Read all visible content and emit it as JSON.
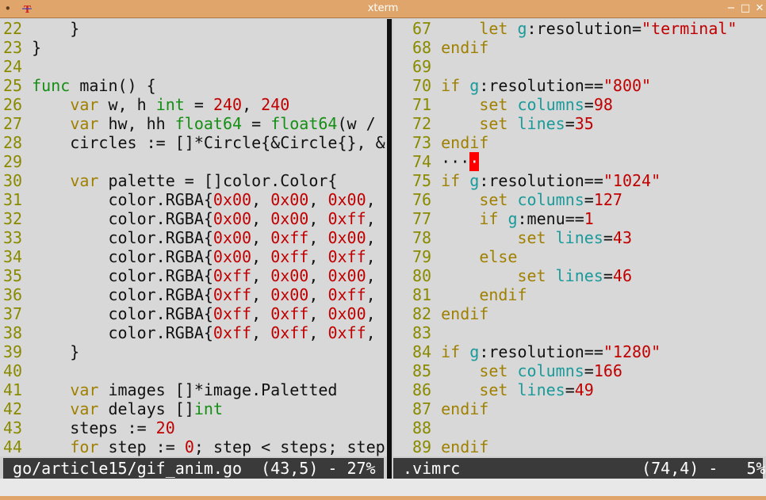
{
  "window": {
    "title": "xterm",
    "menu_glyph": "•",
    "app_glyph": "T",
    "minimize": "−",
    "maximize": "□",
    "close": "✕"
  },
  "left_pane": {
    "lines": [
      [
        {
          "t": "22",
          "c": "ln"
        },
        {
          "t": "     }",
          "c": "pl"
        }
      ],
      [
        {
          "t": "23",
          "c": "ln"
        },
        {
          "t": " }",
          "c": "pl"
        }
      ],
      [
        {
          "t": "24",
          "c": "ln"
        }
      ],
      [
        {
          "t": "25",
          "c": "ln"
        },
        {
          "t": " ",
          "c": "pl"
        },
        {
          "t": "func",
          "c": "ty"
        },
        {
          "t": " main() {",
          "c": "pl"
        }
      ],
      [
        {
          "t": "26",
          "c": "ln"
        },
        {
          "t": "     ",
          "c": "pl"
        },
        {
          "t": "var",
          "c": "kw"
        },
        {
          "t": " w, h ",
          "c": "pl"
        },
        {
          "t": "int",
          "c": "ty"
        },
        {
          "t": " = ",
          "c": "pl"
        },
        {
          "t": "240",
          "c": "nm"
        },
        {
          "t": ", ",
          "c": "pl"
        },
        {
          "t": "240",
          "c": "nm"
        }
      ],
      [
        {
          "t": "27",
          "c": "ln"
        },
        {
          "t": "     ",
          "c": "pl"
        },
        {
          "t": "var",
          "c": "kw"
        },
        {
          "t": " hw, hh ",
          "c": "pl"
        },
        {
          "t": "float64",
          "c": "ty"
        },
        {
          "t": " = ",
          "c": "pl"
        },
        {
          "t": "float64",
          "c": "ty"
        },
        {
          "t": "(w /",
          "c": "pl"
        }
      ],
      [
        {
          "t": "28",
          "c": "ln"
        },
        {
          "t": "     circles := []*Circle{&Circle{}, &",
          "c": "pl"
        }
      ],
      [
        {
          "t": "29",
          "c": "ln"
        }
      ],
      [
        {
          "t": "30",
          "c": "ln"
        },
        {
          "t": "     ",
          "c": "pl"
        },
        {
          "t": "var",
          "c": "kw"
        },
        {
          "t": " palette = []color.Color{",
          "c": "pl"
        }
      ],
      [
        {
          "t": "31",
          "c": "ln"
        },
        {
          "t": "         color.RGBA{",
          "c": "pl"
        },
        {
          "t": "0x00",
          "c": "nm"
        },
        {
          "t": ", ",
          "c": "pl"
        },
        {
          "t": "0x00",
          "c": "nm"
        },
        {
          "t": ", ",
          "c": "pl"
        },
        {
          "t": "0x00",
          "c": "nm"
        },
        {
          "t": ",",
          "c": "pl"
        }
      ],
      [
        {
          "t": "32",
          "c": "ln"
        },
        {
          "t": "         color.RGBA{",
          "c": "pl"
        },
        {
          "t": "0x00",
          "c": "nm"
        },
        {
          "t": ", ",
          "c": "pl"
        },
        {
          "t": "0x00",
          "c": "nm"
        },
        {
          "t": ", ",
          "c": "pl"
        },
        {
          "t": "0xff",
          "c": "nm"
        },
        {
          "t": ",",
          "c": "pl"
        }
      ],
      [
        {
          "t": "33",
          "c": "ln"
        },
        {
          "t": "         color.RGBA{",
          "c": "pl"
        },
        {
          "t": "0x00",
          "c": "nm"
        },
        {
          "t": ", ",
          "c": "pl"
        },
        {
          "t": "0xff",
          "c": "nm"
        },
        {
          "t": ", ",
          "c": "pl"
        },
        {
          "t": "0x00",
          "c": "nm"
        },
        {
          "t": ",",
          "c": "pl"
        }
      ],
      [
        {
          "t": "34",
          "c": "ln"
        },
        {
          "t": "         color.RGBA{",
          "c": "pl"
        },
        {
          "t": "0x00",
          "c": "nm"
        },
        {
          "t": ", ",
          "c": "pl"
        },
        {
          "t": "0xff",
          "c": "nm"
        },
        {
          "t": ", ",
          "c": "pl"
        },
        {
          "t": "0xff",
          "c": "nm"
        },
        {
          "t": ",",
          "c": "pl"
        }
      ],
      [
        {
          "t": "35",
          "c": "ln"
        },
        {
          "t": "         color.RGBA{",
          "c": "pl"
        },
        {
          "t": "0xff",
          "c": "nm"
        },
        {
          "t": ", ",
          "c": "pl"
        },
        {
          "t": "0x00",
          "c": "nm"
        },
        {
          "t": ", ",
          "c": "pl"
        },
        {
          "t": "0x00",
          "c": "nm"
        },
        {
          "t": ",",
          "c": "pl"
        }
      ],
      [
        {
          "t": "36",
          "c": "ln"
        },
        {
          "t": "         color.RGBA{",
          "c": "pl"
        },
        {
          "t": "0xff",
          "c": "nm"
        },
        {
          "t": ", ",
          "c": "pl"
        },
        {
          "t": "0x00",
          "c": "nm"
        },
        {
          "t": ", ",
          "c": "pl"
        },
        {
          "t": "0xff",
          "c": "nm"
        },
        {
          "t": ",",
          "c": "pl"
        }
      ],
      [
        {
          "t": "37",
          "c": "ln"
        },
        {
          "t": "         color.RGBA{",
          "c": "pl"
        },
        {
          "t": "0xff",
          "c": "nm"
        },
        {
          "t": ", ",
          "c": "pl"
        },
        {
          "t": "0xff",
          "c": "nm"
        },
        {
          "t": ", ",
          "c": "pl"
        },
        {
          "t": "0x00",
          "c": "nm"
        },
        {
          "t": ",",
          "c": "pl"
        }
      ],
      [
        {
          "t": "38",
          "c": "ln"
        },
        {
          "t": "         color.RGBA{",
          "c": "pl"
        },
        {
          "t": "0xff",
          "c": "nm"
        },
        {
          "t": ", ",
          "c": "pl"
        },
        {
          "t": "0xff",
          "c": "nm"
        },
        {
          "t": ", ",
          "c": "pl"
        },
        {
          "t": "0xff",
          "c": "nm"
        },
        {
          "t": ",",
          "c": "pl"
        }
      ],
      [
        {
          "t": "39",
          "c": "ln"
        },
        {
          "t": "     }",
          "c": "pl"
        }
      ],
      [
        {
          "t": "40",
          "c": "ln"
        }
      ],
      [
        {
          "t": "41",
          "c": "ln"
        },
        {
          "t": "     ",
          "c": "pl"
        },
        {
          "t": "var",
          "c": "kw"
        },
        {
          "t": " images []*image.Paletted",
          "c": "pl"
        }
      ],
      [
        {
          "t": "42",
          "c": "ln"
        },
        {
          "t": "     ",
          "c": "pl"
        },
        {
          "t": "var",
          "c": "kw"
        },
        {
          "t": " delays []",
          "c": "pl"
        },
        {
          "t": "int",
          "c": "ty"
        }
      ],
      [
        {
          "t": "43",
          "c": "ln"
        },
        {
          "t": "     steps := ",
          "c": "pl"
        },
        {
          "t": "20",
          "c": "nm"
        }
      ],
      [
        {
          "t": "44",
          "c": "ln"
        },
        {
          "t": "     ",
          "c": "pl"
        },
        {
          "t": "for",
          "c": "kw"
        },
        {
          "t": " step := ",
          "c": "pl"
        },
        {
          "t": "0",
          "c": "nm"
        },
        {
          "t": "; step < steps; step",
          "c": "pl"
        }
      ]
    ]
  },
  "right_pane": {
    "lines": [
      [
        {
          "t": "67",
          "c": "ln"
        },
        {
          "t": "     ",
          "c": "pl"
        },
        {
          "t": "let",
          "c": "kw"
        },
        {
          "t": " ",
          "c": "pl"
        },
        {
          "t": "g",
          "c": "id"
        },
        {
          "t": ":resolution=",
          "c": "pl"
        },
        {
          "t": "\"terminal\"",
          "c": "st"
        }
      ],
      [
        {
          "t": "68",
          "c": "ln"
        },
        {
          "t": " ",
          "c": "pl"
        },
        {
          "t": "endif",
          "c": "kw"
        }
      ],
      [
        {
          "t": "69",
          "c": "ln"
        }
      ],
      [
        {
          "t": "70",
          "c": "ln"
        },
        {
          "t": " ",
          "c": "pl"
        },
        {
          "t": "if",
          "c": "kw"
        },
        {
          "t": " ",
          "c": "pl"
        },
        {
          "t": "g",
          "c": "id"
        },
        {
          "t": ":resolution==",
          "c": "pl"
        },
        {
          "t": "\"800\"",
          "c": "st"
        },
        {
          "t": "             \"",
          "c": "bl"
        }
      ],
      [
        {
          "t": "71",
          "c": "ln"
        },
        {
          "t": "     ",
          "c": "pl"
        },
        {
          "t": "set",
          "c": "kw"
        },
        {
          "t": " ",
          "c": "pl"
        },
        {
          "t": "columns",
          "c": "id"
        },
        {
          "t": "=",
          "c": "pl"
        },
        {
          "t": "98",
          "c": "nm"
        }
      ],
      [
        {
          "t": "72",
          "c": "ln"
        },
        {
          "t": "     ",
          "c": "pl"
        },
        {
          "t": "set",
          "c": "kw"
        },
        {
          "t": " ",
          "c": "pl"
        },
        {
          "t": "lines",
          "c": "id"
        },
        {
          "t": "=",
          "c": "pl"
        },
        {
          "t": "35",
          "c": "nm"
        }
      ],
      [
        {
          "t": "73",
          "c": "ln"
        },
        {
          "t": " ",
          "c": "pl"
        },
        {
          "t": "endif",
          "c": "kw"
        }
      ],
      [
        {
          "t": "74",
          "c": "ln"
        },
        {
          "t": " ···",
          "c": "pl"
        },
        {
          "t": "·",
          "c": "cur"
        }
      ],
      [
        {
          "t": "75",
          "c": "ln"
        },
        {
          "t": " ",
          "c": "pl"
        },
        {
          "t": "if",
          "c": "kw"
        },
        {
          "t": " ",
          "c": "pl"
        },
        {
          "t": "g",
          "c": "id"
        },
        {
          "t": ":resolution==",
          "c": "pl"
        },
        {
          "t": "\"1024\"",
          "c": "st"
        },
        {
          "t": "            \"",
          "c": "bl"
        }
      ],
      [
        {
          "t": "76",
          "c": "ln"
        },
        {
          "t": "     ",
          "c": "pl"
        },
        {
          "t": "set",
          "c": "kw"
        },
        {
          "t": " ",
          "c": "pl"
        },
        {
          "t": "columns",
          "c": "id"
        },
        {
          "t": "=",
          "c": "pl"
        },
        {
          "t": "127",
          "c": "nm"
        }
      ],
      [
        {
          "t": "77",
          "c": "ln"
        },
        {
          "t": "     ",
          "c": "pl"
        },
        {
          "t": "if",
          "c": "kw"
        },
        {
          "t": " ",
          "c": "pl"
        },
        {
          "t": "g",
          "c": "id"
        },
        {
          "t": ":menu==",
          "c": "pl"
        },
        {
          "t": "1",
          "c": "nm"
        }
      ],
      [
        {
          "t": "78",
          "c": "ln"
        },
        {
          "t": "         ",
          "c": "pl"
        },
        {
          "t": "set",
          "c": "kw"
        },
        {
          "t": " ",
          "c": "pl"
        },
        {
          "t": "lines",
          "c": "id"
        },
        {
          "t": "=",
          "c": "pl"
        },
        {
          "t": "43",
          "c": "nm"
        }
      ],
      [
        {
          "t": "79",
          "c": "ln"
        },
        {
          "t": "     ",
          "c": "pl"
        },
        {
          "t": "else",
          "c": "kw"
        }
      ],
      [
        {
          "t": "80",
          "c": "ln"
        },
        {
          "t": "         ",
          "c": "pl"
        },
        {
          "t": "set",
          "c": "kw"
        },
        {
          "t": " ",
          "c": "pl"
        },
        {
          "t": "lines",
          "c": "id"
        },
        {
          "t": "=",
          "c": "pl"
        },
        {
          "t": "46",
          "c": "nm"
        }
      ],
      [
        {
          "t": "81",
          "c": "ln"
        },
        {
          "t": "     ",
          "c": "pl"
        },
        {
          "t": "endif",
          "c": "kw"
        }
      ],
      [
        {
          "t": "82",
          "c": "ln"
        },
        {
          "t": " ",
          "c": "pl"
        },
        {
          "t": "endif",
          "c": "kw"
        }
      ],
      [
        {
          "t": "83",
          "c": "ln"
        }
      ],
      [
        {
          "t": "84",
          "c": "ln"
        },
        {
          "t": " ",
          "c": "pl"
        },
        {
          "t": "if",
          "c": "kw"
        },
        {
          "t": " ",
          "c": "pl"
        },
        {
          "t": "g",
          "c": "id"
        },
        {
          "t": ":resolution==",
          "c": "pl"
        },
        {
          "t": "\"1280\"",
          "c": "st"
        },
        {
          "t": "            \"",
          "c": "bl"
        }
      ],
      [
        {
          "t": "85",
          "c": "ln"
        },
        {
          "t": "     ",
          "c": "pl"
        },
        {
          "t": "set",
          "c": "kw"
        },
        {
          "t": " ",
          "c": "pl"
        },
        {
          "t": "columns",
          "c": "id"
        },
        {
          "t": "=",
          "c": "pl"
        },
        {
          "t": "166",
          "c": "nm"
        }
      ],
      [
        {
          "t": "86",
          "c": "ln"
        },
        {
          "t": "     ",
          "c": "pl"
        },
        {
          "t": "set",
          "c": "kw"
        },
        {
          "t": " ",
          "c": "pl"
        },
        {
          "t": "lines",
          "c": "id"
        },
        {
          "t": "=",
          "c": "pl"
        },
        {
          "t": "49",
          "c": "nm"
        }
      ],
      [
        {
          "t": "87",
          "c": "ln"
        },
        {
          "t": " ",
          "c": "pl"
        },
        {
          "t": "endif",
          "c": "kw"
        }
      ],
      [
        {
          "t": "88",
          "c": "ln"
        }
      ],
      [
        {
          "t": "89",
          "c": "ln"
        },
        {
          "t": " ",
          "c": "pl"
        },
        {
          "t": "endif",
          "c": "kw"
        }
      ]
    ]
  },
  "status": {
    "left": " go/article15/gif_anim.go  (43,5) - 27%",
    "right": " .vimrc                   (74,4) -   5%"
  }
}
